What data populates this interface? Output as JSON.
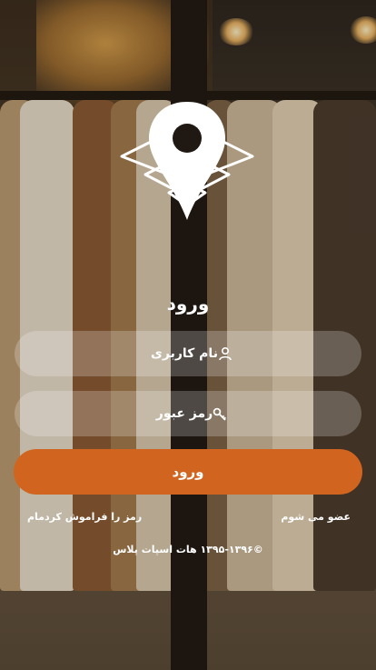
{
  "login": {
    "title": "ورود",
    "username_placeholder": "نام کاربری",
    "password_placeholder": "رمز عبور",
    "submit_label": "ورود",
    "join_link": "عضو می شوم",
    "forgot_link": "رمز را فراموش کردمام",
    "copyright": "©۱۳۹۵-۱۳۹۶ هات اسپات پلاس"
  },
  "icons": {
    "logo": "location-wifi-logo",
    "username": "user-icon",
    "password": "key-icon"
  },
  "colors": {
    "accent": "#d1651f",
    "field_bg": "rgba(255,255,255,0.22)",
    "text": "#ffffff"
  }
}
